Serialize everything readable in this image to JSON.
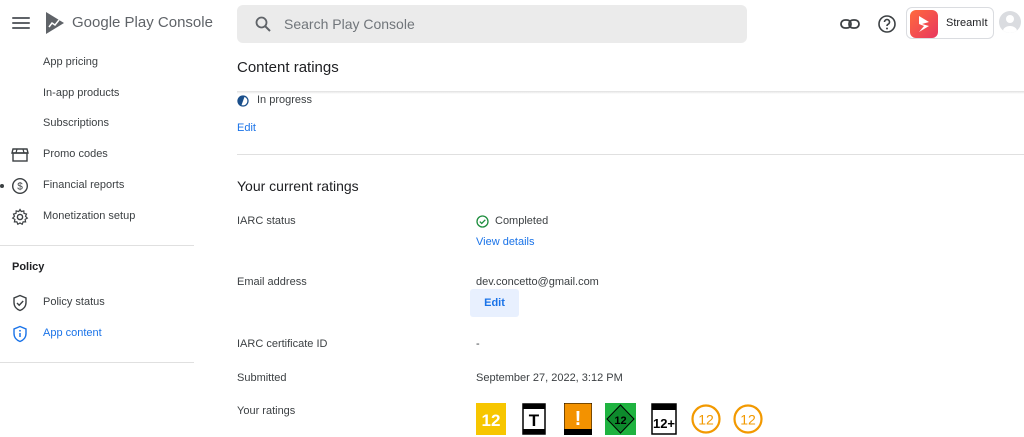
{
  "header": {
    "brand_name": "Google Play",
    "brand_suffix": "Console",
    "search_placeholder": "Search Play Console",
    "app_name": "StreamIt"
  },
  "sidebar": {
    "items_monetize": [
      {
        "label": "App pricing",
        "icon": "none"
      },
      {
        "label": "In-app products",
        "icon": "none"
      },
      {
        "label": "Subscriptions",
        "icon": "none"
      },
      {
        "label": "Promo codes",
        "icon": "store-icon"
      },
      {
        "label": "Financial reports",
        "icon": "dollar-icon"
      },
      {
        "label": "Monetization setup",
        "icon": "gear-icon"
      }
    ],
    "policy_section": "Policy",
    "items_policy": [
      {
        "label": "Policy status",
        "icon": "shield-check-icon"
      },
      {
        "label": "App content",
        "icon": "shield-info-icon",
        "active": true
      }
    ]
  },
  "main": {
    "page_title": "Content ratings",
    "progress_status": "In progress",
    "edit_link": "Edit",
    "current_ratings": {
      "title": "Your current ratings",
      "iarc_status_label": "IARC status",
      "iarc_status_value": "Completed",
      "view_details": "View details",
      "email_label": "Email address",
      "email_value": "dev.concetto@gmail.com",
      "email_edit": "Edit",
      "certificate_label": "IARC certificate ID",
      "certificate_value": "-",
      "submitted_label": "Submitted",
      "submitted_value": "September 27, 2022, 3:12 PM",
      "ratings_label": "Your ratings",
      "ratings": [
        {
          "system": "PEGI",
          "label": "12"
        },
        {
          "system": "ESRB",
          "label": "T"
        },
        {
          "system": "ClassInd",
          "label": "!"
        },
        {
          "system": "USK",
          "label": "12"
        },
        {
          "system": "IARC",
          "label": "12+"
        },
        {
          "system": "Generic",
          "label": "12"
        },
        {
          "system": "Generic",
          "label": "12"
        }
      ]
    }
  },
  "colors": {
    "accent": "#1a73e8",
    "success": "#1e8e3e",
    "pegi": "#f7c600",
    "usk": "#1fb340",
    "generic_ring": "#f29900"
  }
}
